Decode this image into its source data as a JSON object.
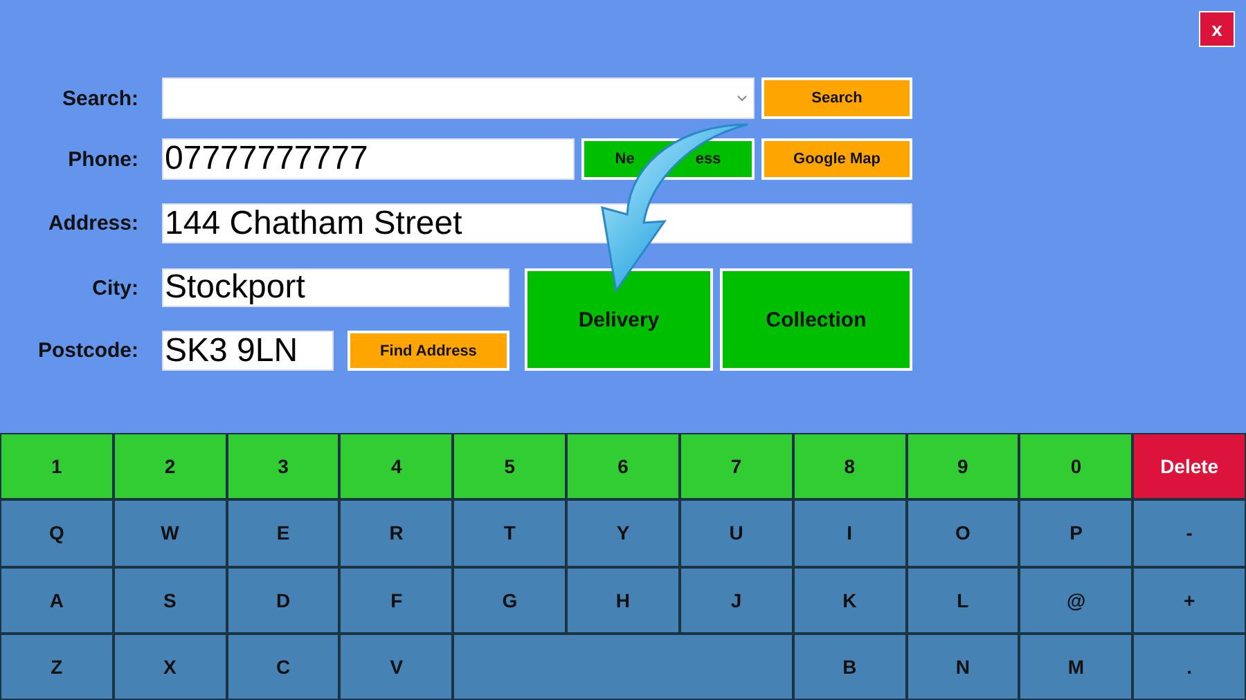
{
  "close_button": {
    "label": "x"
  },
  "form": {
    "search": {
      "label": "Search:",
      "button": "Search"
    },
    "phone": {
      "label": "Phone:",
      "value": "07777777777",
      "new_address_button": {
        "label_parts": [
          "Ne",
          "ess"
        ]
      },
      "map_button": "Google Map"
    },
    "address": {
      "label": "Address:",
      "value": "144 Chatham Street"
    },
    "city": {
      "label": "City:",
      "value": "Stockport"
    },
    "postcode": {
      "label": "Postcode:",
      "value": "SK3 9LN",
      "button": "Find Address"
    },
    "order_types": [
      "Delivery",
      "Collection"
    ]
  },
  "keyboard": {
    "rows": [
      [
        {
          "label": "1",
          "kind": "digit"
        },
        {
          "label": "2",
          "kind": "digit"
        },
        {
          "label": "3",
          "kind": "digit"
        },
        {
          "label": "4",
          "kind": "digit"
        },
        {
          "label": "5",
          "kind": "digit"
        },
        {
          "label": "6",
          "kind": "digit"
        },
        {
          "label": "7",
          "kind": "digit"
        },
        {
          "label": "8",
          "kind": "digit"
        },
        {
          "label": "9",
          "kind": "digit"
        },
        {
          "label": "0",
          "kind": "digit"
        },
        {
          "label": "Delete",
          "kind": "delete"
        }
      ],
      [
        {
          "label": "Q",
          "kind": "letter"
        },
        {
          "label": "W",
          "kind": "letter"
        },
        {
          "label": "E",
          "kind": "letter"
        },
        {
          "label": "R",
          "kind": "letter"
        },
        {
          "label": "T",
          "kind": "letter"
        },
        {
          "label": "Y",
          "kind": "letter"
        },
        {
          "label": "U",
          "kind": "letter"
        },
        {
          "label": "I",
          "kind": "letter"
        },
        {
          "label": "O",
          "kind": "letter"
        },
        {
          "label": "P",
          "kind": "letter"
        },
        {
          "label": "-",
          "kind": "letter"
        }
      ],
      [
        {
          "label": "A",
          "kind": "letter"
        },
        {
          "label": "S",
          "kind": "letter"
        },
        {
          "label": "D",
          "kind": "letter"
        },
        {
          "label": "F",
          "kind": "letter"
        },
        {
          "label": "G",
          "kind": "letter"
        },
        {
          "label": "H",
          "kind": "letter"
        },
        {
          "label": "J",
          "kind": "letter"
        },
        {
          "label": "K",
          "kind": "letter"
        },
        {
          "label": "L",
          "kind": "letter"
        },
        {
          "label": "@",
          "kind": "letter"
        },
        {
          "label": "+",
          "kind": "letter"
        }
      ],
      [
        {
          "label": "Z",
          "kind": "letter"
        },
        {
          "label": "X",
          "kind": "letter"
        },
        {
          "label": "C",
          "kind": "letter"
        },
        {
          "label": "V",
          "kind": "letter"
        },
        {
          "kind": "space"
        },
        {
          "kind": "continued"
        },
        {
          "kind": "continued"
        },
        {
          "label": "B",
          "kind": "letter"
        },
        {
          "label": "N",
          "kind": "letter"
        },
        {
          "label": "M",
          "kind": "letter"
        },
        {
          "label": ".",
          "kind": "letter"
        }
      ]
    ]
  }
}
